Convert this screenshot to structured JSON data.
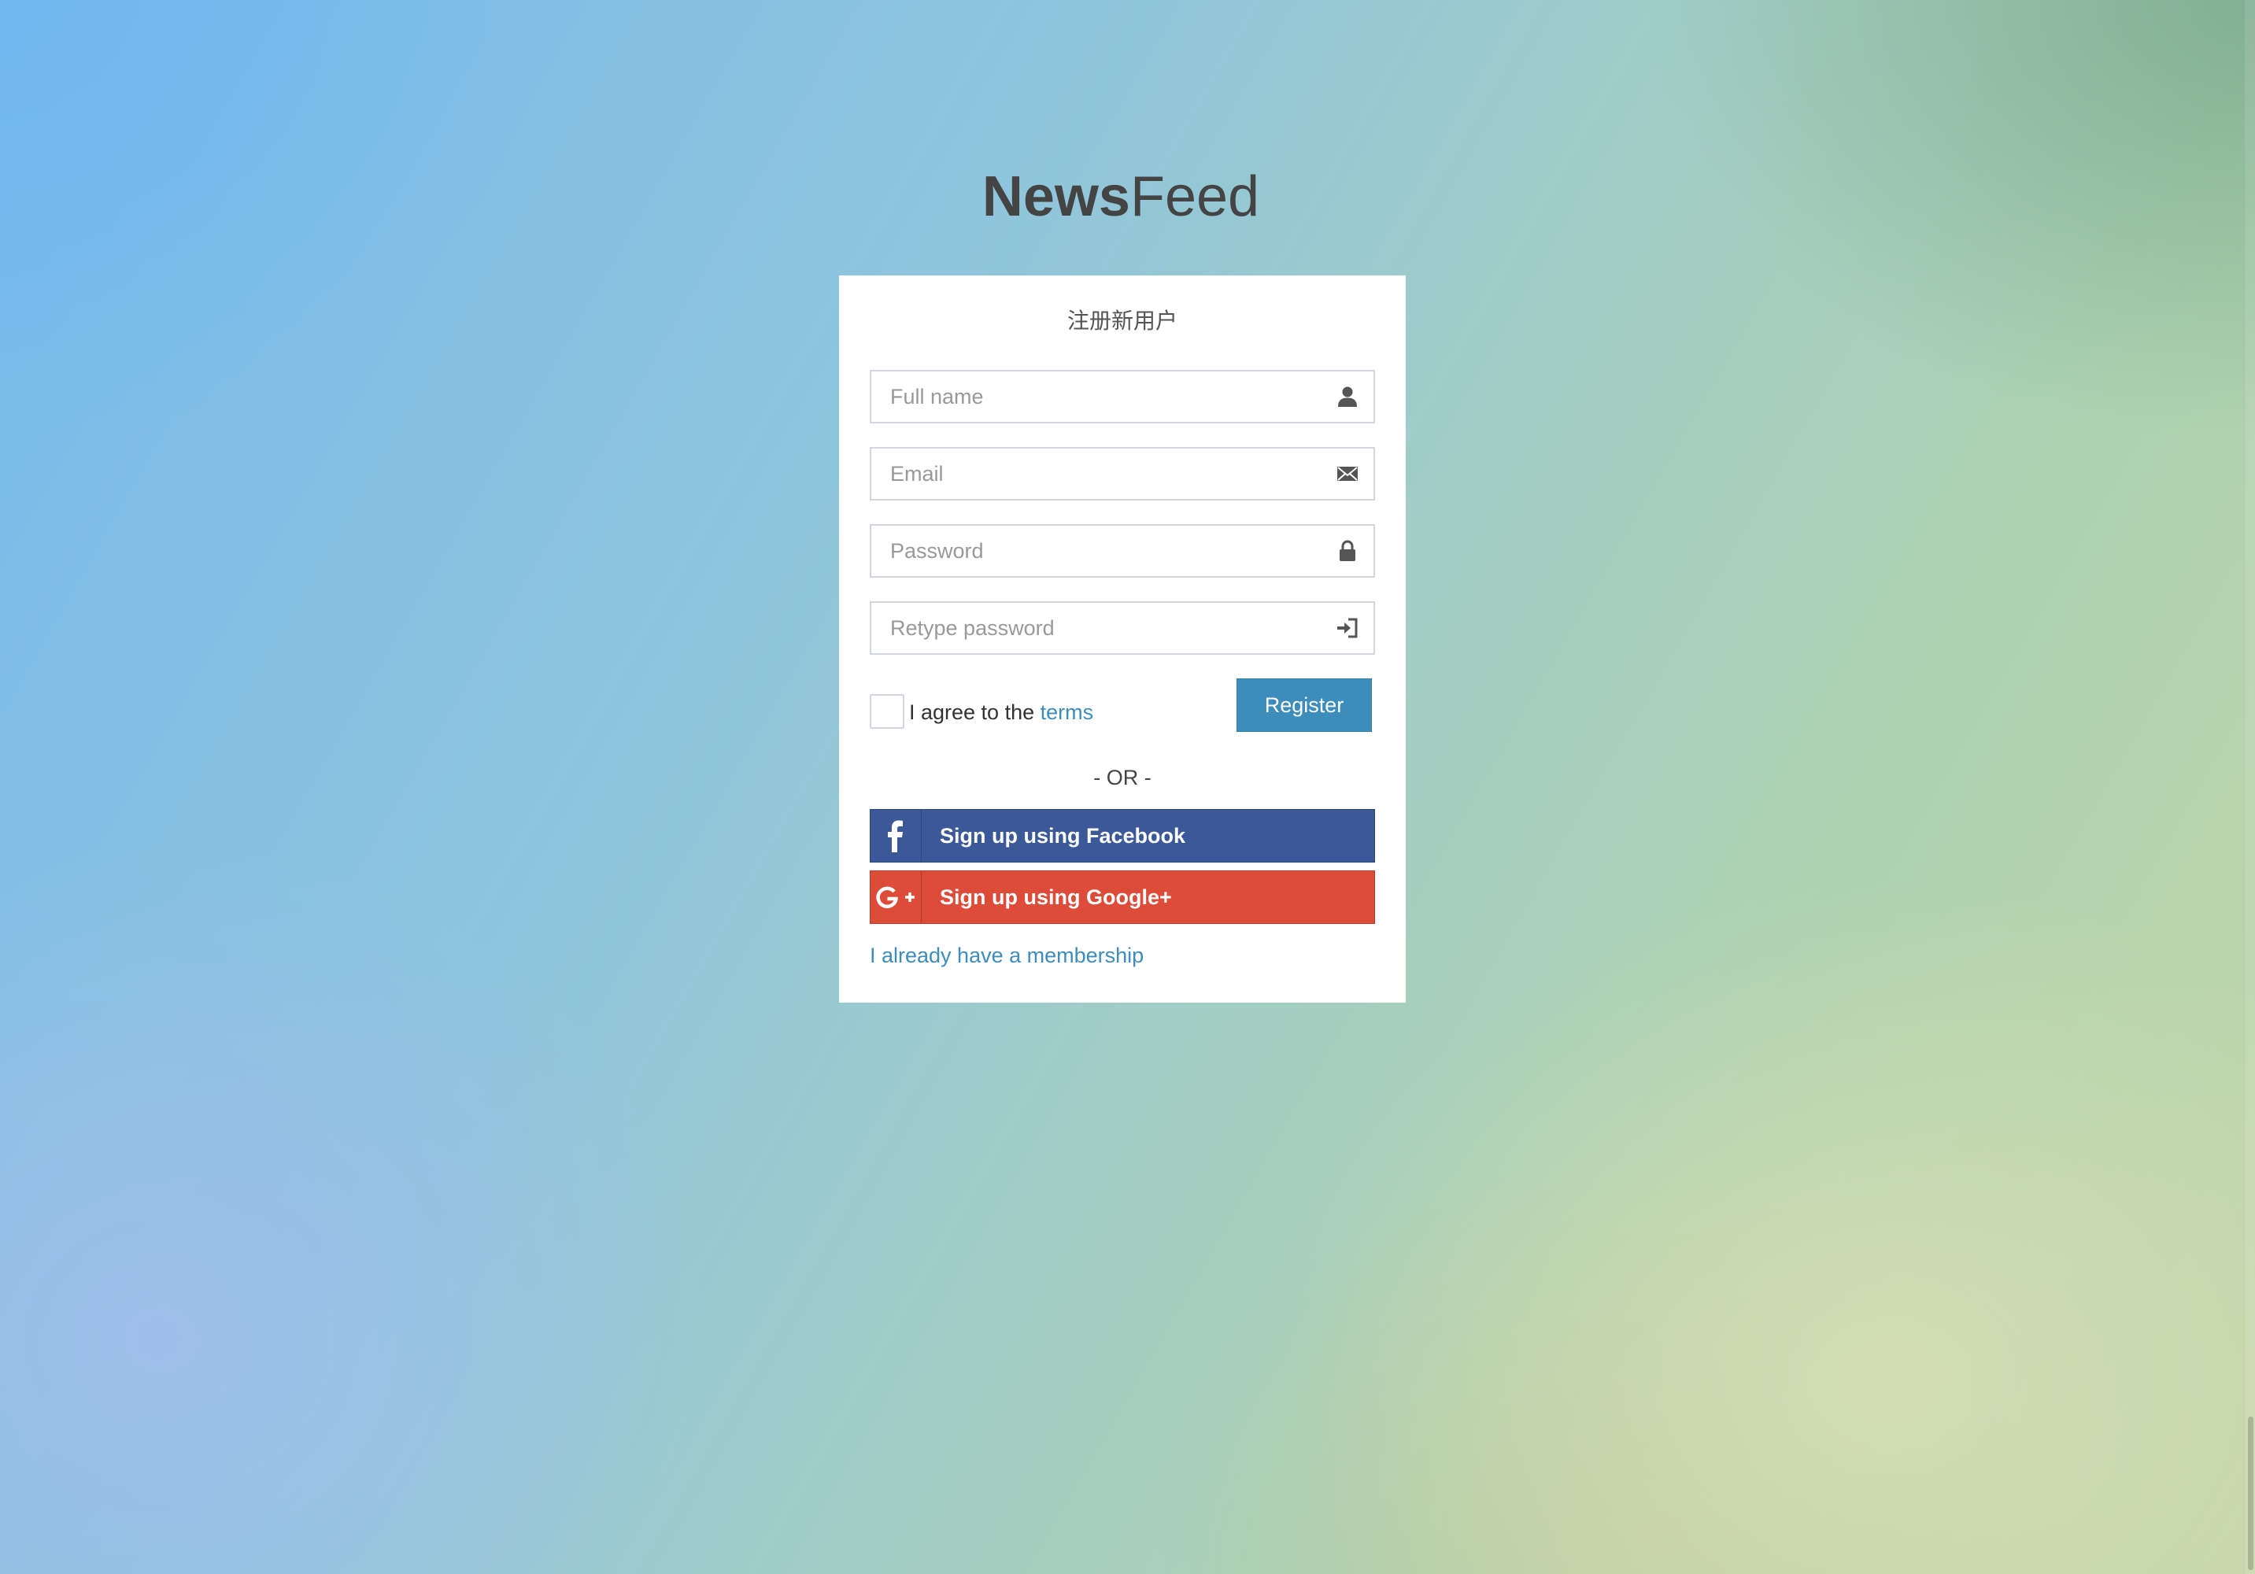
{
  "logo": {
    "bold": "News",
    "light": "Feed"
  },
  "form": {
    "title": "注册新用户",
    "fields": [
      {
        "placeholder": "Full name",
        "icon": "user-icon"
      },
      {
        "placeholder": "Email",
        "icon": "envelope-icon"
      },
      {
        "placeholder": "Password",
        "icon": "lock-icon"
      },
      {
        "placeholder": "Retype password",
        "icon": "log-in-icon"
      }
    ],
    "agree_prefix": "I agree to the ",
    "agree_link": "terms",
    "register_label": "Register",
    "or_text": "- OR -",
    "facebook_label": "Sign up using Facebook",
    "google_label": "Sign up using Google+",
    "member_link": "I already have a membership"
  },
  "colors": {
    "accent": "#3c8dbc",
    "facebook": "#3b5998",
    "google": "#dd4b39",
    "logo_text": "#444444"
  }
}
